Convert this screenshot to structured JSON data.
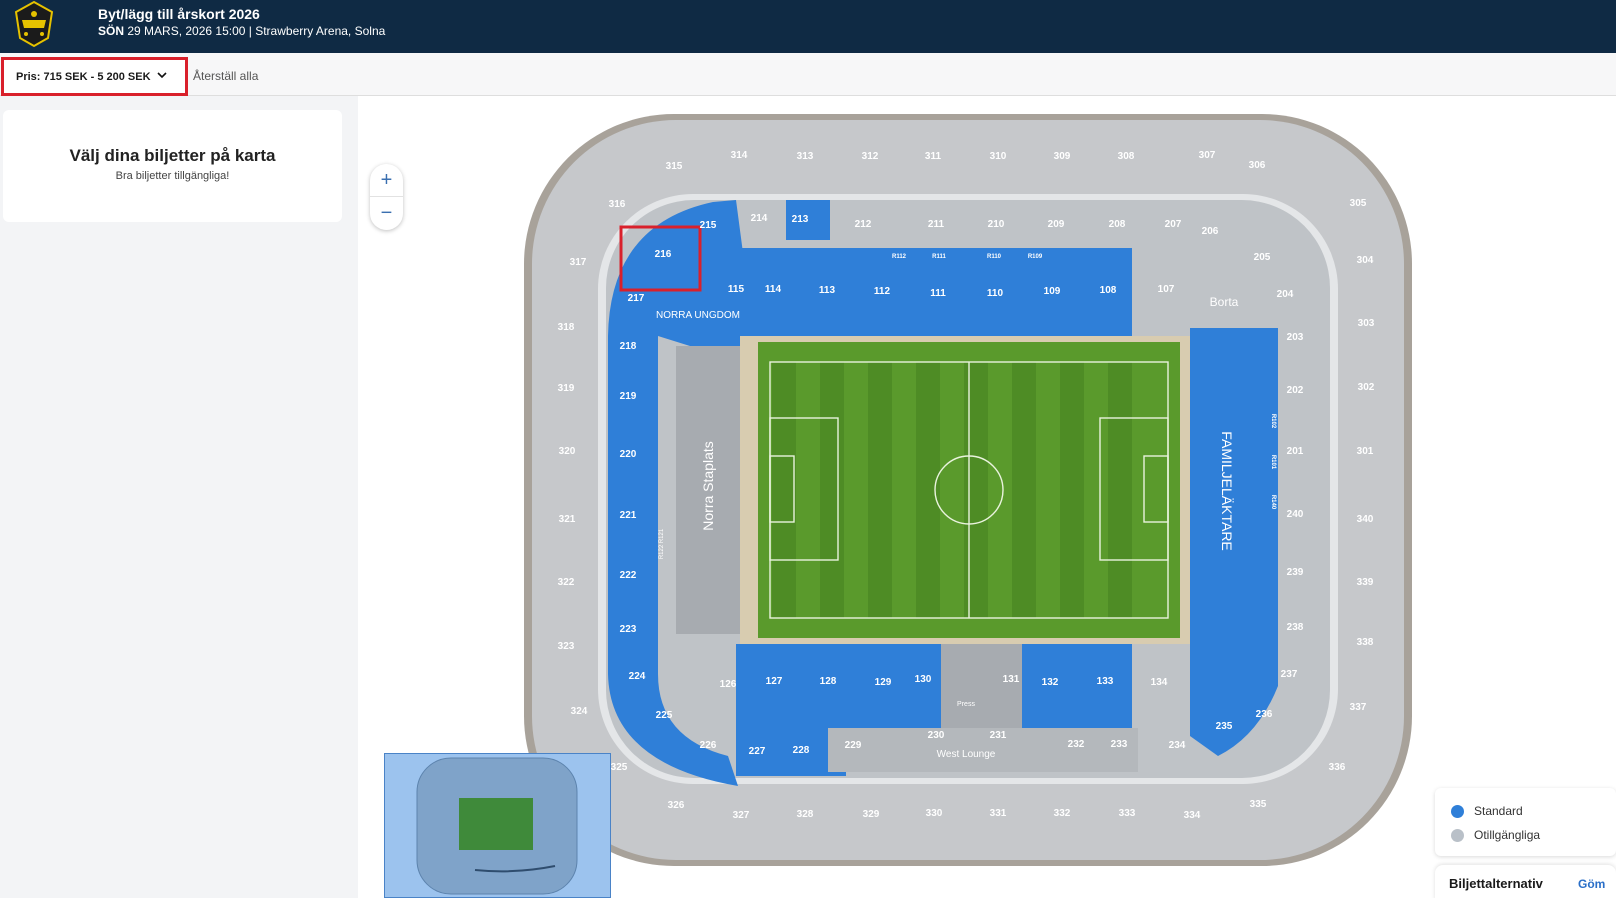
{
  "header": {
    "title": "Byt/lägg till årskort 2026",
    "day": "SÖN",
    "date_venue": "29 MARS, 2026 15:00 | Strawberry Arena, Solna"
  },
  "filters": {
    "price_label": "Pris: 715 SEK - 5 200 SEK",
    "reset_label": "Återställ alla"
  },
  "panel": {
    "title": "Välj dina biljetter på karta",
    "subtitle": "Bra biljetter tillgängliga!"
  },
  "map": {
    "sections_300_top": [
      "315",
      "314",
      "313",
      "312",
      "311",
      "310",
      "309",
      "308",
      "307",
      "306"
    ],
    "sections_300_right": [
      "305",
      "304",
      "303",
      "302",
      "301",
      "340",
      "339",
      "338",
      "337",
      "336",
      "335"
    ],
    "sections_300_bottom": [
      "334",
      "333",
      "332",
      "331",
      "330",
      "329",
      "328",
      "327",
      "326",
      "325"
    ],
    "sections_300_left": [
      "324",
      "323",
      "322",
      "321",
      "320",
      "319",
      "318",
      "317",
      "316"
    ],
    "sections_200_top": [
      "215",
      "214",
      "213",
      "212",
      "211",
      "210",
      "209",
      "208",
      "207",
      "206"
    ],
    "sections_200_right": [
      "205",
      "204",
      "203",
      "202",
      "201",
      "240",
      "239",
      "238",
      "237",
      "236",
      "235"
    ],
    "sections_200_bottom": [
      "234",
      "233",
      "232",
      "231",
      "230",
      "229",
      "228",
      "227",
      "226",
      "225"
    ],
    "sections_200_left": [
      "216",
      "217",
      "218",
      "219",
      "220",
      "221",
      "222",
      "223",
      "224"
    ],
    "sections_100_top": [
      "115",
      "114",
      "113",
      "112",
      "111",
      "110",
      "109",
      "108",
      "107"
    ],
    "sections_100_bottom": [
      "126",
      "127",
      "128",
      "129",
      "130",
      "131",
      "132",
      "133",
      "134"
    ],
    "row_labels_top": [
      "R112",
      "R111",
      "R110",
      "R109"
    ],
    "row_labels_left": "R122 R121",
    "row_labels_right": [
      "R102",
      "R101",
      "R140"
    ],
    "stand_names": {
      "north_youth": "NORRA UNGDOM",
      "north_standing": "Norra Staplats",
      "family": "FAMILJELÄKTARE",
      "away": "Borta",
      "west_lounge": "West Lounge",
      "press": "Press"
    },
    "highlighted_section": "216"
  },
  "legend": {
    "items": [
      {
        "label": "Standard",
        "color": "#2f7fd8"
      },
      {
        "label": "Otillgängliga",
        "color": "#b9c0c8"
      }
    ]
  },
  "ticket_options": {
    "title": "Biljettalternativ",
    "hide_label": "Göm"
  },
  "zoom": {
    "in": "+",
    "out": "−"
  }
}
